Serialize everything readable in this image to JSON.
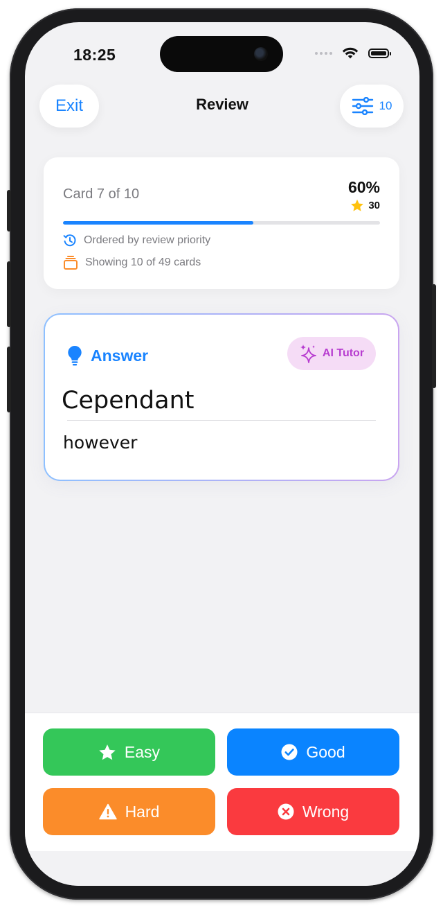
{
  "status": {
    "time": "18:25"
  },
  "nav": {
    "exit_label": "Exit",
    "title": "Review",
    "filter_count": "10"
  },
  "progress": {
    "card_label": "Card 7 of 10",
    "percent_label": "60%",
    "progress_value": 0.6,
    "stars": "30",
    "order_text": "Ordered by review priority",
    "showing_text": "Showing 10 of 49 cards"
  },
  "card": {
    "side_label": "Answer",
    "ai_label": "AI Tutor",
    "term": "Cependant",
    "definition": "however"
  },
  "actions": {
    "easy": "Easy",
    "good": "Good",
    "hard": "Hard",
    "wrong": "Wrong"
  },
  "colors": {
    "accent": "#1a84ff",
    "easy": "#34c759",
    "good": "#0a84ff",
    "hard": "#fb8c2a",
    "wrong": "#fa3a3f",
    "ai": "#b73cd0"
  },
  "icons": [
    "filter-sliders-icon",
    "star-icon",
    "history-icon",
    "card-stack-icon",
    "lightbulb-icon",
    "sparkles-icon",
    "checkmark-circle-icon",
    "warning-icon",
    "x-circle-icon",
    "wifi-icon",
    "battery-icon"
  ]
}
